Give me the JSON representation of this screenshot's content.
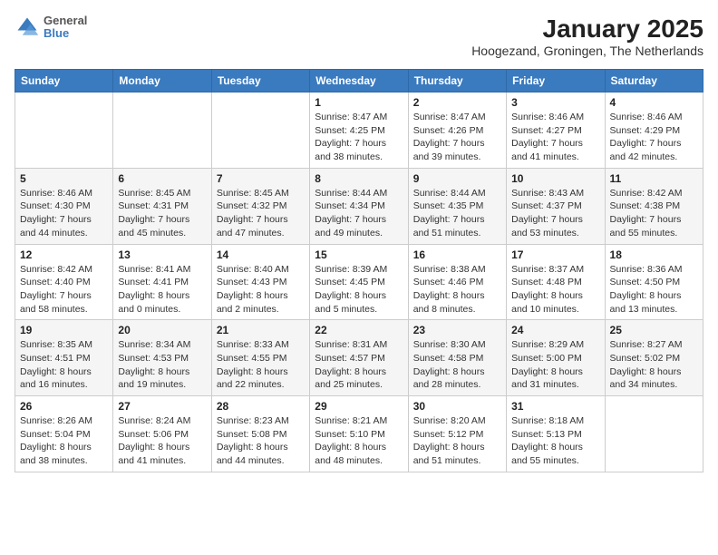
{
  "logo": {
    "line1": "General",
    "line2": "Blue"
  },
  "title": "January 2025",
  "subtitle": "Hoogezand, Groningen, The Netherlands",
  "weekdays": [
    "Sunday",
    "Monday",
    "Tuesday",
    "Wednesday",
    "Thursday",
    "Friday",
    "Saturday"
  ],
  "weeks": [
    [
      {
        "day": "",
        "info": ""
      },
      {
        "day": "",
        "info": ""
      },
      {
        "day": "",
        "info": ""
      },
      {
        "day": "1",
        "info": "Sunrise: 8:47 AM\nSunset: 4:25 PM\nDaylight: 7 hours\nand 38 minutes."
      },
      {
        "day": "2",
        "info": "Sunrise: 8:47 AM\nSunset: 4:26 PM\nDaylight: 7 hours\nand 39 minutes."
      },
      {
        "day": "3",
        "info": "Sunrise: 8:46 AM\nSunset: 4:27 PM\nDaylight: 7 hours\nand 41 minutes."
      },
      {
        "day": "4",
        "info": "Sunrise: 8:46 AM\nSunset: 4:29 PM\nDaylight: 7 hours\nand 42 minutes."
      }
    ],
    [
      {
        "day": "5",
        "info": "Sunrise: 8:46 AM\nSunset: 4:30 PM\nDaylight: 7 hours\nand 44 minutes."
      },
      {
        "day": "6",
        "info": "Sunrise: 8:45 AM\nSunset: 4:31 PM\nDaylight: 7 hours\nand 45 minutes."
      },
      {
        "day": "7",
        "info": "Sunrise: 8:45 AM\nSunset: 4:32 PM\nDaylight: 7 hours\nand 47 minutes."
      },
      {
        "day": "8",
        "info": "Sunrise: 8:44 AM\nSunset: 4:34 PM\nDaylight: 7 hours\nand 49 minutes."
      },
      {
        "day": "9",
        "info": "Sunrise: 8:44 AM\nSunset: 4:35 PM\nDaylight: 7 hours\nand 51 minutes."
      },
      {
        "day": "10",
        "info": "Sunrise: 8:43 AM\nSunset: 4:37 PM\nDaylight: 7 hours\nand 53 minutes."
      },
      {
        "day": "11",
        "info": "Sunrise: 8:42 AM\nSunset: 4:38 PM\nDaylight: 7 hours\nand 55 minutes."
      }
    ],
    [
      {
        "day": "12",
        "info": "Sunrise: 8:42 AM\nSunset: 4:40 PM\nDaylight: 7 hours\nand 58 minutes."
      },
      {
        "day": "13",
        "info": "Sunrise: 8:41 AM\nSunset: 4:41 PM\nDaylight: 8 hours\nand 0 minutes."
      },
      {
        "day": "14",
        "info": "Sunrise: 8:40 AM\nSunset: 4:43 PM\nDaylight: 8 hours\nand 2 minutes."
      },
      {
        "day": "15",
        "info": "Sunrise: 8:39 AM\nSunset: 4:45 PM\nDaylight: 8 hours\nand 5 minutes."
      },
      {
        "day": "16",
        "info": "Sunrise: 8:38 AM\nSunset: 4:46 PM\nDaylight: 8 hours\nand 8 minutes."
      },
      {
        "day": "17",
        "info": "Sunrise: 8:37 AM\nSunset: 4:48 PM\nDaylight: 8 hours\nand 10 minutes."
      },
      {
        "day": "18",
        "info": "Sunrise: 8:36 AM\nSunset: 4:50 PM\nDaylight: 8 hours\nand 13 minutes."
      }
    ],
    [
      {
        "day": "19",
        "info": "Sunrise: 8:35 AM\nSunset: 4:51 PM\nDaylight: 8 hours\nand 16 minutes."
      },
      {
        "day": "20",
        "info": "Sunrise: 8:34 AM\nSunset: 4:53 PM\nDaylight: 8 hours\nand 19 minutes."
      },
      {
        "day": "21",
        "info": "Sunrise: 8:33 AM\nSunset: 4:55 PM\nDaylight: 8 hours\nand 22 minutes."
      },
      {
        "day": "22",
        "info": "Sunrise: 8:31 AM\nSunset: 4:57 PM\nDaylight: 8 hours\nand 25 minutes."
      },
      {
        "day": "23",
        "info": "Sunrise: 8:30 AM\nSunset: 4:58 PM\nDaylight: 8 hours\nand 28 minutes."
      },
      {
        "day": "24",
        "info": "Sunrise: 8:29 AM\nSunset: 5:00 PM\nDaylight: 8 hours\nand 31 minutes."
      },
      {
        "day": "25",
        "info": "Sunrise: 8:27 AM\nSunset: 5:02 PM\nDaylight: 8 hours\nand 34 minutes."
      }
    ],
    [
      {
        "day": "26",
        "info": "Sunrise: 8:26 AM\nSunset: 5:04 PM\nDaylight: 8 hours\nand 38 minutes."
      },
      {
        "day": "27",
        "info": "Sunrise: 8:24 AM\nSunset: 5:06 PM\nDaylight: 8 hours\nand 41 minutes."
      },
      {
        "day": "28",
        "info": "Sunrise: 8:23 AM\nSunset: 5:08 PM\nDaylight: 8 hours\nand 44 minutes."
      },
      {
        "day": "29",
        "info": "Sunrise: 8:21 AM\nSunset: 5:10 PM\nDaylight: 8 hours\nand 48 minutes."
      },
      {
        "day": "30",
        "info": "Sunrise: 8:20 AM\nSunset: 5:12 PM\nDaylight: 8 hours\nand 51 minutes."
      },
      {
        "day": "31",
        "info": "Sunrise: 8:18 AM\nSunset: 5:13 PM\nDaylight: 8 hours\nand 55 minutes."
      },
      {
        "day": "",
        "info": ""
      }
    ]
  ]
}
